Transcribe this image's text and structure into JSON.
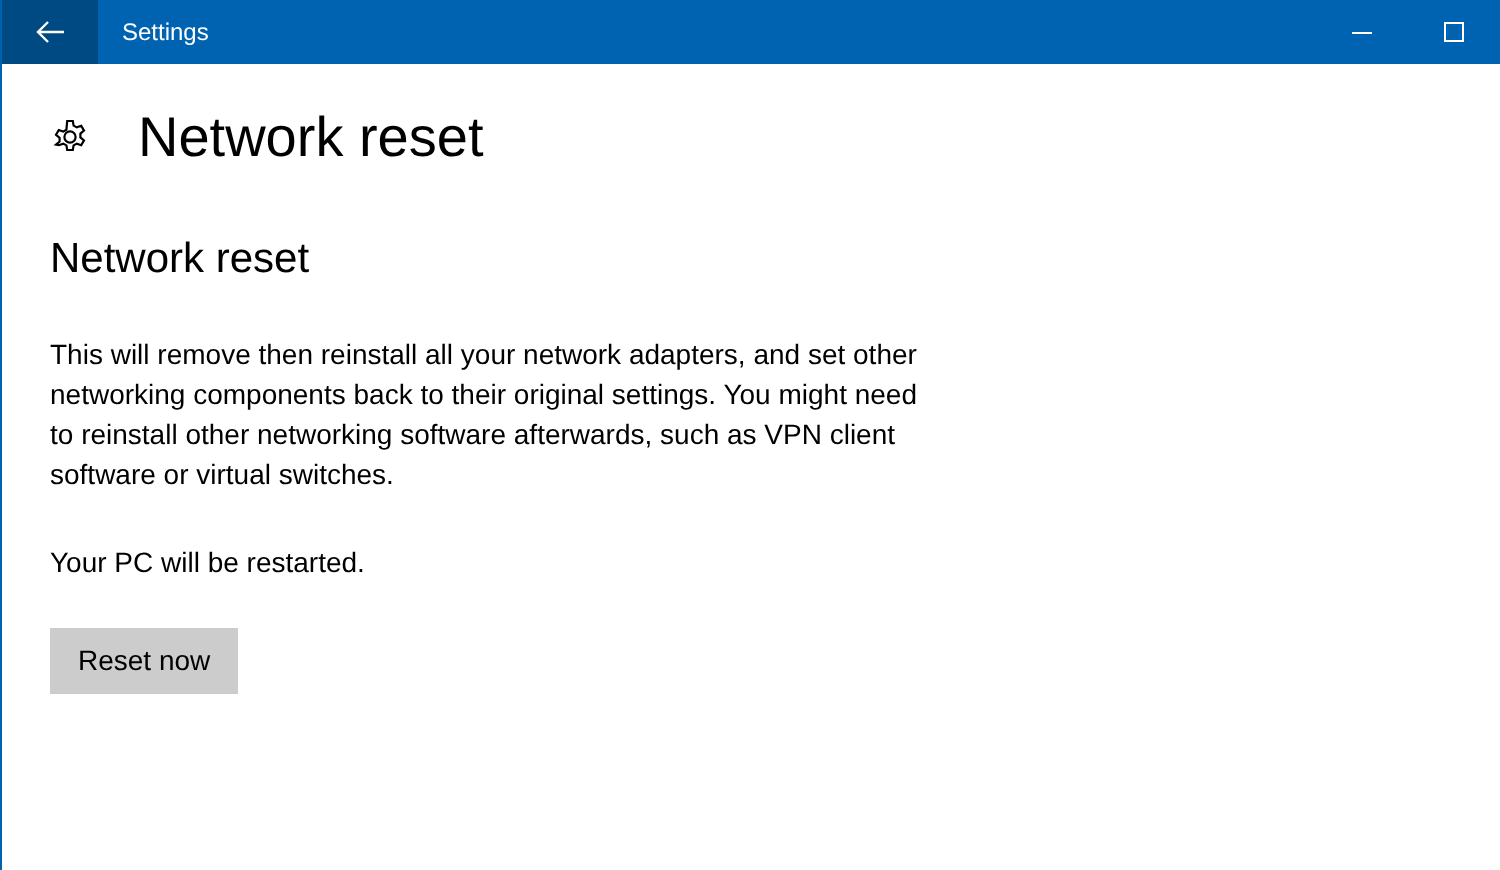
{
  "window": {
    "title": "Settings"
  },
  "page": {
    "title": "Network reset"
  },
  "section": {
    "heading": "Network reset",
    "description": "This will remove then reinstall all your network adapters, and set other networking components back to their original settings. You might need to reinstall other networking software afterwards, such as VPN client software or virtual switches.",
    "note": "Your PC will be restarted.",
    "button": "Reset now"
  }
}
